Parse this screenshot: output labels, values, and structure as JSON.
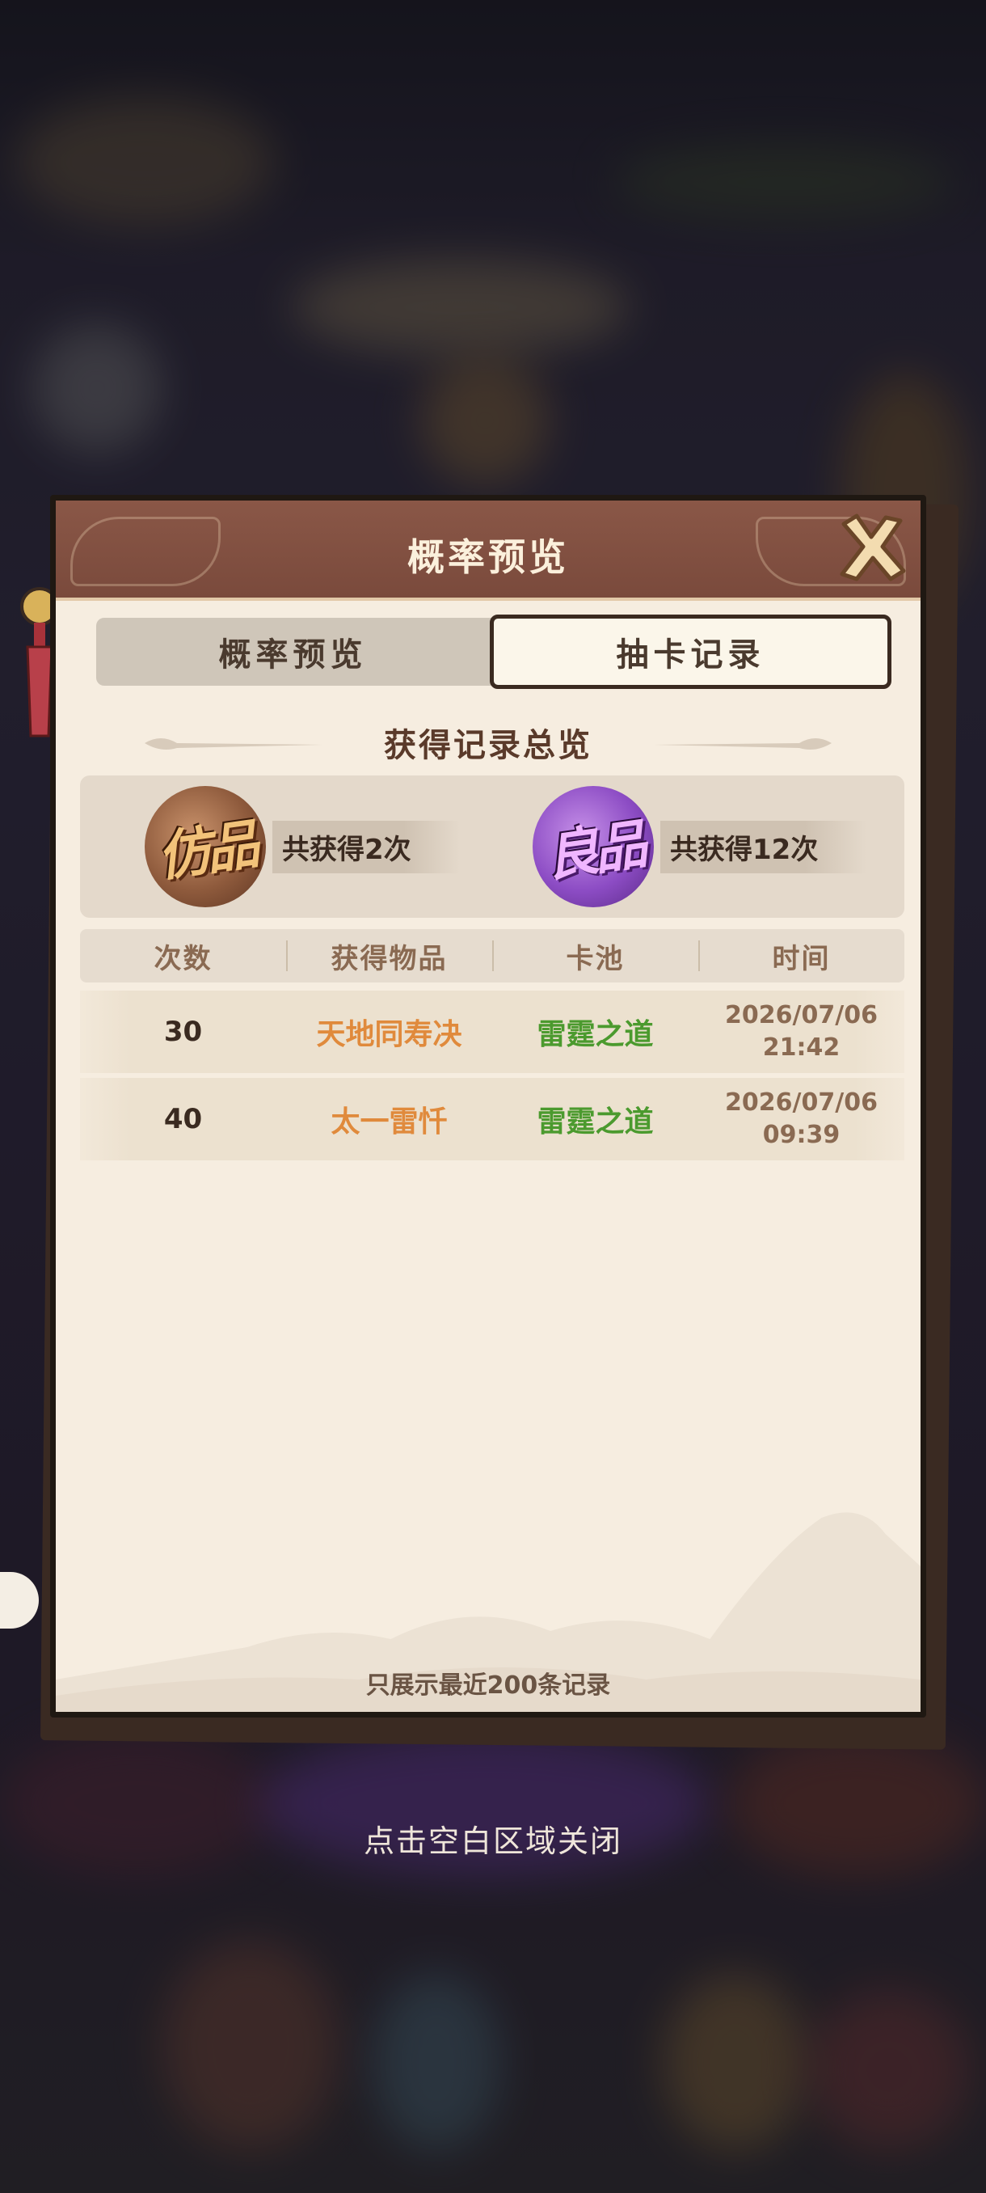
{
  "modal": {
    "title": "概率预览",
    "close_icon": "close-x-icon",
    "tabs": [
      {
        "label": "概率预览",
        "active": false
      },
      {
        "label": "抽卡记录",
        "active": true
      }
    ]
  },
  "summary": {
    "title": "获得记录总览",
    "items": [
      {
        "grade": "仿品",
        "count_text": "共获得2次",
        "color": "#c9926b"
      },
      {
        "grade": "良品",
        "count_text": "共获得12次",
        "color": "#8c4cc4"
      }
    ]
  },
  "table": {
    "headers": [
      "次数",
      "获得物品",
      "卡池",
      "时间"
    ],
    "rows": [
      {
        "count": "30",
        "item": "天地同寿决",
        "pool": "雷霆之道",
        "date": "2026/07/06",
        "time": "21:42"
      },
      {
        "count": "40",
        "item": "太一雷忏",
        "pool": "雷霆之道",
        "date": "2026/07/06",
        "time": "09:39"
      }
    ]
  },
  "footer_note": "只展示最近200条记录",
  "close_hint": "点击空白区域关闭",
  "colors": {
    "header_brown": "#7a4a3c",
    "panel_bg": "#f6ede0",
    "item_orange": "#e08a3c",
    "pool_green": "#4b9a2e"
  }
}
